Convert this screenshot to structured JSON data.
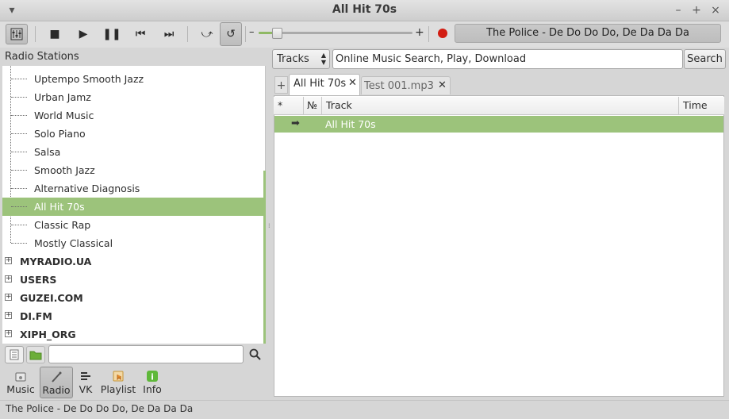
{
  "window": {
    "title": "All Hit 70s"
  },
  "toolbar": {
    "equalizer_icon": "equalizer-icon",
    "stop_icon": "stop-icon",
    "play_icon": "play-icon",
    "pause_icon": "pause-icon",
    "prev_icon": "previous-icon",
    "next_icon": "next-icon",
    "shuffle_icon": "shuffle-icon",
    "repeat_icon": "repeat-icon",
    "volume_minus": "–",
    "volume_plus": "+",
    "volume_level": 0.12,
    "record_color": "#d21d12",
    "now_playing": "The Police - De Do Do Do, De Da Da Da"
  },
  "left_panel": {
    "header": "Radio Stations",
    "children": [
      "Uptempo Smooth Jazz",
      "Urban Jamz",
      "World Music",
      "Solo Piano",
      "Salsa",
      "Smooth Jazz",
      "Alternative Diagnosis",
      "All Hit 70s",
      "Classic Rap",
      "Mostly Classical"
    ],
    "selected_index": 7,
    "groups": [
      "MYRADIO.UA",
      "USERS",
      "GUZEI.COM",
      "DI.FM",
      "XIPH_ORG"
    ],
    "search": {
      "value": "",
      "placeholder": ""
    }
  },
  "modes": [
    {
      "label": "Music",
      "icon": "music-disk-icon"
    },
    {
      "label": "Radio",
      "icon": "radio-antenna-icon"
    },
    {
      "label": "VK",
      "icon": "vk-icon"
    },
    {
      "label": "Playlist",
      "icon": "playlist-icon"
    },
    {
      "label": "Info",
      "icon": "info-icon"
    }
  ],
  "right_panel": {
    "search_type": "Tracks",
    "search_value": "Online Music Search, Play, Download",
    "search_button": "Search",
    "tabs": [
      {
        "label": "All Hit 70s",
        "active": true
      },
      {
        "label": "Test 001.mp3",
        "active": false
      }
    ],
    "add_tab": "+",
    "columns": [
      "*",
      "№",
      "Track",
      "Time"
    ],
    "rows": [
      {
        "star": "",
        "num": "",
        "track": "All Hit 70s",
        "time": "",
        "playing": true
      }
    ]
  },
  "status_bar": {
    "text": "The Police - De Do Do Do, De Da Da Da"
  },
  "colors": {
    "accent": "#9cc37b",
    "background": "#d6d6d6"
  }
}
